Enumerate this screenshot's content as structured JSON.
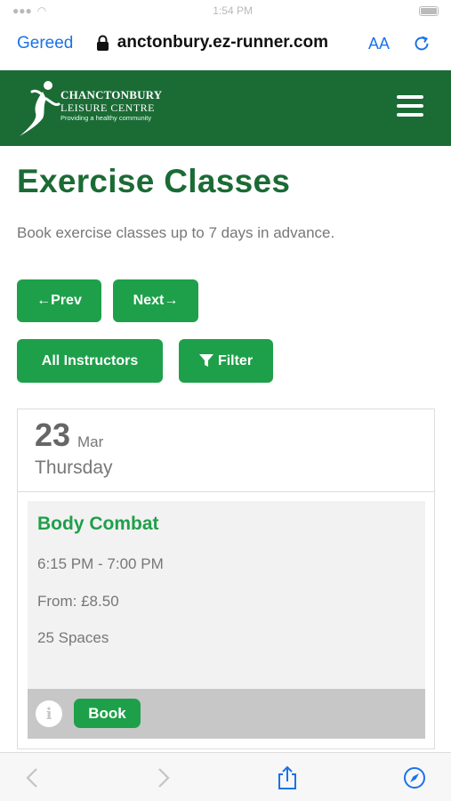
{
  "status_bar": {
    "time": "1:54 PM"
  },
  "browser": {
    "done_label": "Gereed",
    "url": " anctonbury.ez-runner.com",
    "text_size_label": "AA"
  },
  "header": {
    "logo_line1": "CHANCTONBURY",
    "logo_line2": "LEISURE CENTRE",
    "logo_tagline": "Providing a healthy community"
  },
  "page": {
    "title": "Exercise Classes",
    "subtitle": "Book exercise classes up to 7 days in advance."
  },
  "nav": {
    "prev_label": "←Prev",
    "next_label": "Next→",
    "instructors_label": "All Instructors",
    "filter_label": "Filter"
  },
  "schedule": {
    "day_number": "23",
    "month": "Mar",
    "weekday": "Thursday",
    "classes": [
      {
        "name": "Body Combat",
        "time": "6:15 PM - 7:00 PM",
        "price": "From: £8.50",
        "spaces": "25 Spaces",
        "book_label": "Book"
      }
    ]
  },
  "colors": {
    "brand_green": "#1b6b35",
    "button_green": "#1ea04a",
    "link_blue": "#1a73e8"
  }
}
